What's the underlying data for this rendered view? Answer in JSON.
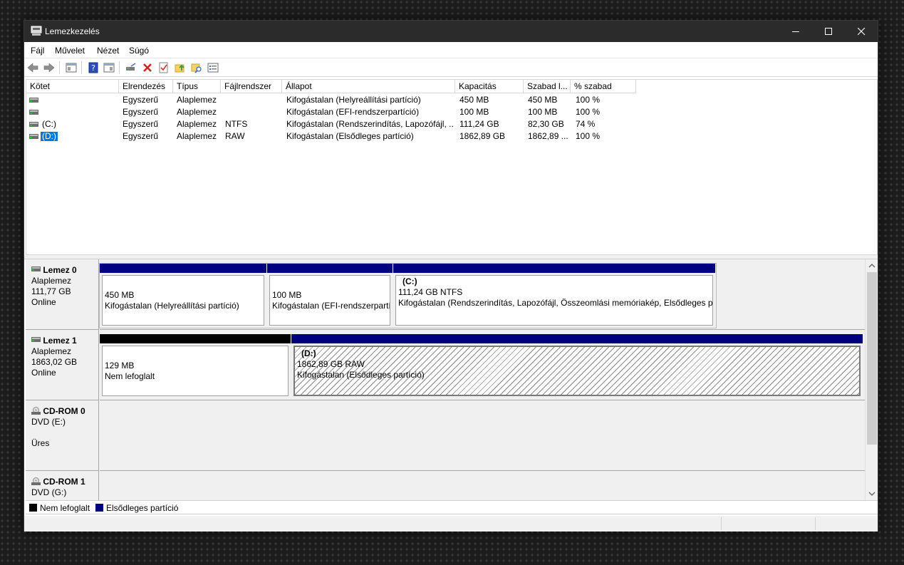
{
  "window": {
    "title": "Lemezkezelés"
  },
  "menu": [
    "Fájl",
    "Művelet",
    "Nézet",
    "Súgó"
  ],
  "volume_table": {
    "columns": [
      "Kötet",
      "Elrendezés",
      "Típus",
      "Fájlrendszer",
      "Állapot",
      "Kapacitás",
      "Szabad l...",
      "% szabad"
    ],
    "rows": [
      {
        "volume": "",
        "layout": "Egyszerű",
        "type": "Alaplemez",
        "fs": "",
        "status": "Kifogástalan (Helyreállítási partíció)",
        "capacity": "450 MB",
        "free": "450 MB",
        "pct": "100 %"
      },
      {
        "volume": "",
        "layout": "Egyszerű",
        "type": "Alaplemez",
        "fs": "",
        "status": "Kifogástalan (EFI-rendszerpartíció)",
        "capacity": "100 MB",
        "free": "100 MB",
        "pct": "100 %"
      },
      {
        "volume": "(C:)",
        "layout": "Egyszerű",
        "type": "Alaplemez",
        "fs": "NTFS",
        "status": "Kifogástalan (Rendszerindítás, Lapozófájl, ...",
        "capacity": "111,24 GB",
        "free": "82,30 GB",
        "pct": "74 %"
      },
      {
        "volume": "(D:)",
        "layout": "Egyszerű",
        "type": "Alaplemez",
        "fs": "RAW",
        "status": "Kifogástalan (Elsődleges partíció)",
        "capacity": "1862,89 GB",
        "free": "1862,89 ...",
        "pct": "100 %"
      }
    ]
  },
  "disks": [
    {
      "name": "Lemez 0",
      "kind": "Alaplemez",
      "size": "111,77 GB",
      "state": "Online",
      "partitions": [
        {
          "title": "",
          "size": "450 MB",
          "status": "Kifogástalan (Helyreállítási partíció)"
        },
        {
          "title": "",
          "size": "100 MB",
          "status": "Kifogástalan (EFI-rendszerpartíció)"
        },
        {
          "title": "(C:)",
          "size": "111,24 GB NTFS",
          "status": "Kifogástalan (Rendszerindítás, Lapozófájl, Összeomlási memóriakép, Elsődleges partíció)"
        }
      ]
    },
    {
      "name": "Lemez 1",
      "kind": "Alaplemez",
      "size": "1863,02 GB",
      "state": "Online",
      "partitions": [
        {
          "title": "",
          "size": "129 MB",
          "status": "Nem lefoglalt"
        },
        {
          "title": "(D:)",
          "size": "1862,89 GB RAW",
          "status": "Kifogástalan (Elsődleges partíció)"
        }
      ]
    },
    {
      "name": "CD-ROM 0",
      "kind": "DVD (E:)",
      "state": "Üres"
    },
    {
      "name": "CD-ROM 1",
      "kind": "DVD (G:)"
    }
  ],
  "legend": [
    {
      "label": "Nem lefoglalt",
      "color": "#000000"
    },
    {
      "label": "Elsődleges partíció",
      "color": "#00007f"
    }
  ],
  "colors": {
    "primary": "#00007f",
    "unallocated": "#000000",
    "selection": "#0078d7"
  }
}
